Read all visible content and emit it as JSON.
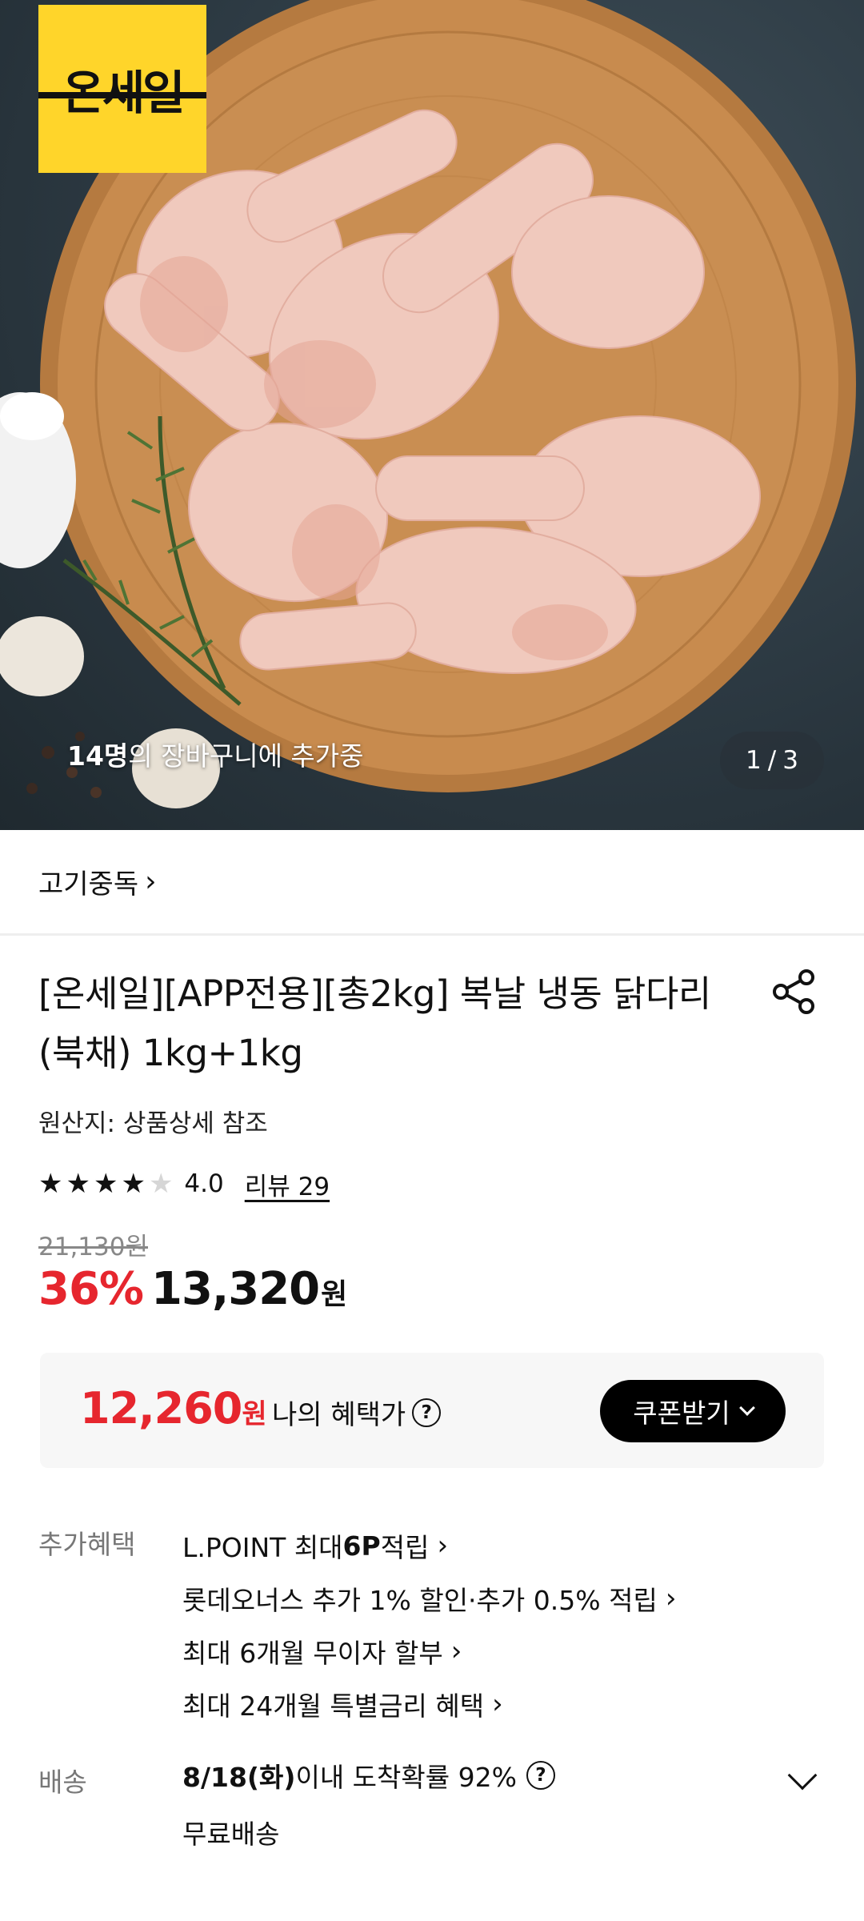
{
  "hero": {
    "logo_text": "온세일",
    "cart_count_bold": "14명",
    "cart_count_rest": "의 장바구니에 추가중",
    "pager_current": "1",
    "pager_sep": "/",
    "pager_total": "3"
  },
  "brand": {
    "name": "고기중독",
    "chevron": "›"
  },
  "product": {
    "title": "[온세일][APP전용][총2kg] 복날 냉동 닭다리(북채) 1kg+1kg",
    "origin": "원산지: 상품상세 참조",
    "rating_value": 4.0,
    "rating_text": "4.0",
    "review_link": "리뷰 29",
    "original_price": "21,130원",
    "discount": "36%",
    "sale_price": "13,320",
    "currency": "원"
  },
  "benefit_box": {
    "my_price": "12,260",
    "currency": "원",
    "label": "나의 혜택가",
    "help_icon": "?",
    "coupon_button": "쿠폰받기"
  },
  "extra_benefits": {
    "label": "추가혜택",
    "items": [
      {
        "pre": "L.POINT 최대 ",
        "bold": "6P",
        "post": " 적립"
      },
      {
        "pre": "롯데오너스 추가 1% 할인·추가 0.5% 적립",
        "bold": "",
        "post": ""
      },
      {
        "pre": "최대 6개월 무이자 할부",
        "bold": "",
        "post": ""
      },
      {
        "pre": "최대 24개월 특별금리 혜택",
        "bold": "",
        "post": ""
      }
    ],
    "chevron": "›"
  },
  "shipping": {
    "label": "배송",
    "date": "8/18(화)",
    "arrival_text": " 이내 도착확률 92%",
    "help_icon": "?",
    "fee": "무료배송"
  },
  "icons": {
    "share": "share-icon",
    "star": "star-icon",
    "help": "question-circle-icon",
    "chevron_down": "chevron-down-icon"
  },
  "colors": {
    "accent_red": "#e6262e",
    "logo_yellow": "#ffd52a",
    "button_black": "#000000"
  }
}
